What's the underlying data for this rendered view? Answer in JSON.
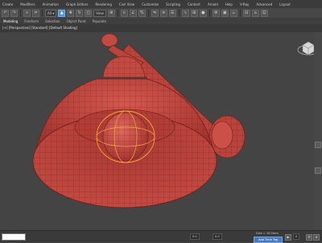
{
  "menubar": {
    "items": [
      "Create",
      "Modifiers",
      "Animation",
      "Graph Editors",
      "Rendering",
      "Civil View",
      "Customize",
      "Scripting",
      "Content",
      "Arnold",
      "Help",
      "V-Ray",
      "Advanced",
      "Layout"
    ]
  },
  "toolbar": {
    "view_select": "View",
    "icons": [
      "undo-icon",
      "redo-icon",
      "link-icon",
      "unlink-icon",
      "select-icon",
      "move-icon",
      "rotate-icon",
      "scale-icon",
      "snap-icon",
      "mirror-icon",
      "align-icon",
      "layer-icon",
      "curve-editor-icon",
      "material-editor-icon",
      "render-setup-icon",
      "render-icon"
    ]
  },
  "ribbon": {
    "tabs": [
      "Modeling",
      "Freeform",
      "Selection",
      "Object Paint",
      "Populate"
    ]
  },
  "viewport": {
    "label": "[+] [Perspective] [Standard] [Default Shading]"
  },
  "colors": {
    "mesh": "#c94b44",
    "wire": "#6e1d17",
    "selection_gizmo": "#f2a63a",
    "background": "#444444"
  },
  "status": {
    "grid": "Grid = 10.0mm",
    "x_value": "0.0",
    "y_value": "0.0",
    "add_time_tag": "Add Time Tag",
    "frame": "0"
  }
}
